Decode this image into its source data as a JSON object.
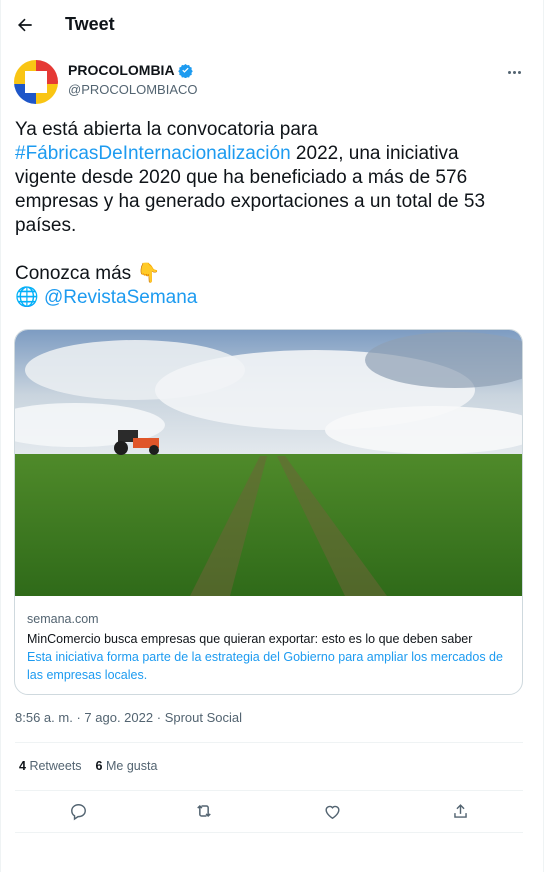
{
  "header": {
    "title": "Tweet"
  },
  "user": {
    "name": "PROCOLOMBIA",
    "handle": "@PROCOLOMBIACO",
    "verified_color": "#1d9bf0"
  },
  "tweet": {
    "line1_pre": "Ya está abierta la convocatoria para ",
    "hashtag": "#FábricasDeInternacionalización",
    "line1_post": " 2022, una iniciativa vigente desde 2020 que ha beneficiado a más de 576 empresas y ha generado exportaciones a un total de 53 países.",
    "more_text": "Conozca más ",
    "pointing_emoji": "👇",
    "globe_emoji": "🌐",
    "mention": "@RevistaSemana"
  },
  "card": {
    "domain": "semana.com",
    "title": "MinComercio busca empresas que quieran exportar: esto es lo que deben saber",
    "description": "Esta iniciativa forma parte de la estrategia del Gobierno para ampliar los mercados de las empresas locales."
  },
  "meta": {
    "time": "8:56 a. m.",
    "date": "7 ago. 2022",
    "source": "Sprout Social",
    "dot": "·"
  },
  "stats": {
    "retweets_count": "4",
    "retweets_label": "Retweets",
    "likes_count": "6",
    "likes_label": "Me gusta"
  },
  "colors": {
    "accent": "#1d9bf0",
    "text": "#0f1419",
    "muted": "#536471",
    "border": "#cfd9de"
  },
  "icons": [
    "back-arrow-icon",
    "verified-badge-icon",
    "more-icon",
    "reply-icon",
    "retweet-icon",
    "like-icon",
    "share-icon"
  ]
}
